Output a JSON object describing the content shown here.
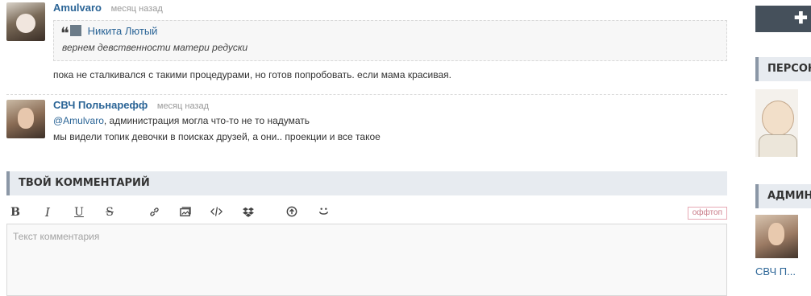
{
  "comments": [
    {
      "author": "Amulvaro",
      "date": "месяц назад",
      "quote": {
        "author": "Никита Лютый",
        "text": "вернем девственности матери редуски"
      },
      "text": "пока не сталкивался с такими процедурами, но готов попробовать. если мама красивая."
    },
    {
      "author": "СВЧ Польнарефф",
      "date": "месяц назад",
      "mention": "@Amulvaro",
      "line1_rest": ", администрация могла что-то не то надумать",
      "line2": "мы видели топик девочки в поисках друзей, а они.. проекции и все такое"
    }
  ],
  "reply": {
    "title": "ТВОЙ КОММЕНТАРИЙ",
    "toolbar": {
      "bold": "B",
      "italic": "I",
      "underline": "U",
      "strike": "S",
      "link_icon": "link-icon",
      "image_icon": "image-icon",
      "code_icon": "code-icon",
      "dropbox_icon": "dropbox-icon",
      "upload_icon": "upload-icon",
      "smile_icon": "smile-icon"
    },
    "offtop": "оффтоп",
    "placeholder": "Текст комментария"
  },
  "sidebar": {
    "add_icon": "plus-icon",
    "section1_title": "ПЕРСОНАЖ",
    "section2_title": "АДМИН",
    "admin_name": "СВЧ П..."
  },
  "colors": {
    "link": "#2a6496",
    "header_bg": "#e7ebf0",
    "header_accent": "#8b97a6",
    "sidebar_button": "#45505b",
    "offtop_border": "#e7aab5"
  }
}
